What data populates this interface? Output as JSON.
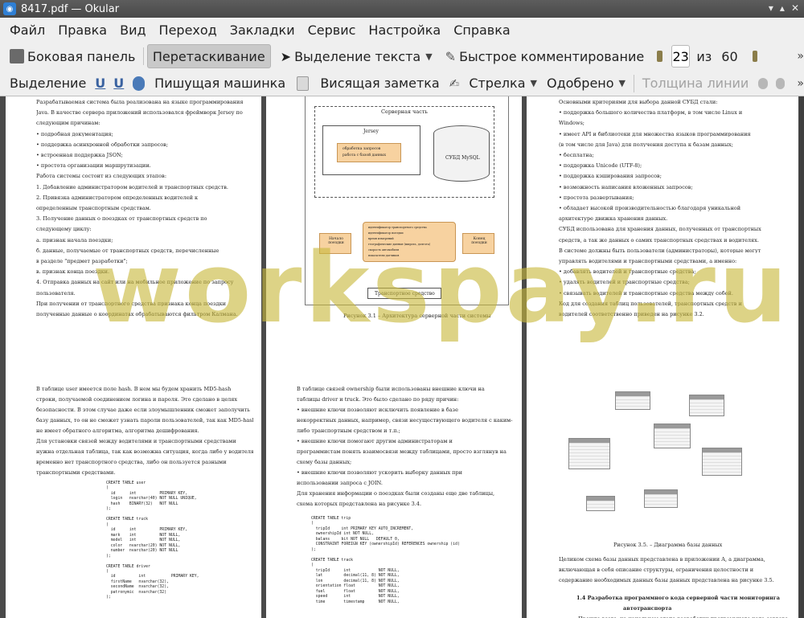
{
  "window": {
    "title": "8417.pdf — Okular"
  },
  "menu": [
    "Файл",
    "Правка",
    "Вид",
    "Переход",
    "Закладки",
    "Сервис",
    "Настройка",
    "Справка"
  ],
  "toolbar1": {
    "sidebar": "Боковая панель",
    "drag": "Перетаскивание",
    "select_text": "Выделение текста",
    "quick_comment": "Быстрое комментирование",
    "current_page": "23",
    "of_label": "из",
    "total_pages": "60"
  },
  "toolbar2": {
    "selection": "Выделение",
    "typewriter": "Пишущая машинка",
    "sticky_note": "Висящая заметка",
    "arrow": "Стрелка",
    "approved": "Одобрено",
    "line_width": "Толщина линии"
  },
  "watermark": "workspay.ru",
  "pages": {
    "p20": {
      "number": "20",
      "lines": [
        "Разрабатываемая система была реализована на языке программирования",
        "Java. В качестве сервера приложений использовался фреймворк Jersey по",
        "следующим причинам:",
        "•       подробная документация;",
        "•       поддержка асинхронной обработки запросов;",
        "•       встроенная поддержка JSON;",
        "•       простота организации маршрутизации.",
        "Работа системы состоит из следующих этапов:",
        "1.      Добавление администратором водителей и транспортных средств.",
        "2.      Привязка администратором определенных водителей к",
        "определенным транспортным средствам.",
        "3.      Получение данных о поездках от транспортных средств по",
        "следующему циклу:",
        "а.      признак начала поездки;",
        "б.      данные, получаемые от транспортных средств, перечисленные",
        "в разделе \"предмет разработки\";",
        "в.      признак конца поездки.",
        "4.      Отправка данных на сайт или на мобильное приложение по запросу",
        "пользователя.",
        "При получении от транспортного средства признака конца поездки",
        "полученные данные о координатах обрабатываются фильтром Калмана."
      ]
    },
    "p21": {
      "number": "21",
      "server_part": "Серверная часть",
      "jersey": "Jersey",
      "jersey_items": [
        "обработка запросов",
        "работа с базой данных"
      ],
      "dbms": "СУБД MySQL",
      "start_trip": "Начало поездки",
      "end_trip": "Конец поездки",
      "middle_items": [
        "идентификатор транспортного средства",
        "идентификатор поездки",
        "время измерений",
        "географические данные (широта, долгота)",
        "скорость автомобиля",
        "показатели датчиков"
      ],
      "vehicle": "Транспортное средство",
      "caption": "Рисунок 3.1 – Архитектура серверной части системы"
    },
    "p22": {
      "number": "22",
      "lines": [
        "Основными критериями для выбора данной СУБД стали:",
        "•       поддержка большого количества платформ, в том числе Linux и",
        "Windows;",
        "•       имеет API и библиотеки для множества языков программирования",
        "(в том числе для Java) для получения доступа к базам данных;",
        "•       бесплатна;",
        "•       поддержка Unicode (UTF-8);",
        "•       поддержка кэширования запросов;",
        "•       возможность написания вложенных запросов;",
        "•       простота развертывания;",
        "•       обладает высокой производительностью благодаря уникальной",
        "архитектуре движка хранения данных.",
        "СУБД использована для хранения данных, полученных от транспортных",
        "средств, а так же данных о самих транспортных средствах и водителях.",
        "В системе должны быть пользователи (администраторы), которые могут",
        "управлять водителями и транспортными средствами, а именно:",
        "•       добавлять водителей и транспортные средства;",
        "•       удалять водителей и транспортные средства;",
        "•       связывать водителей и транспортные средства между собой.",
        "Код для создания таблиц пользователей, транспортных средств и",
        "водителей соответственно приведен на рисунке 3.2."
      ]
    },
    "p23": {
      "lines": [
        "В таблице user имеется поле hash. В нем мы будем хранить MD5-hash",
        "строки, получаемой соединением логина и пароля. Это сделано в целях",
        "безопасности. В этом случае даже если злоумышленник сможет заполучить",
        "базу данных, то он не сможет узнать пароли пользователей, так как MD5-hash",
        "не имеет обратного алгоритма, алгоритма дешифрования.",
        "Для установки связей между водителями и транспортными средствами",
        "нужна отдельная таблица, так как возможна ситуация, когда либо у водителя",
        "временно нет транспортного средства, либо он пользуется разными",
        "транспортными средствами."
      ],
      "code": "CREATE TABLE user\n(\n  id      int          PRIMARY KEY,\n  login   nvarchar(40) NOT NULL UNIQUE,\n  hash    BINARY(32)   NOT NULL\n);\n\nCREATE TABLE truck\n(\n  id      int          PRIMARY KEY,\n  mark    int          NOT NULL,\n  model   int          NOT NULL,\n  color   nvarchar(20) NOT NULL,\n  number  nvarchar(20) NOT NULL\n);\n\nCREATE TABLE driver\n(\n  id          int           PRIMARY KEY,\n  firstName   nvarchar(32),\n  secondName  nvarchar(32),\n  patronymic  nvarchar(32)\n);"
    },
    "p24": {
      "lines": [
        "В таблице связей ownership были использованы внешние ключи на",
        "таблицы driver и truck. Это было сделано по ряду причин:",
        "•       внешние ключи позволяют исключить появление в базе",
        "некорректных данных, например, связи несуществующего водителя с каким-",
        "либо транспортным средством и т.п.;",
        "•       внешние ключи помогают другим администраторам и",
        "программистам понять взаимосвязи между таблицами, просто взглянув на",
        "схему базы данных;",
        "•       внешние ключи позволяют ускорить выборку данных при",
        "использовании запроса с JOIN.",
        "Для хранения информации о поездках были созданы еще две таблицы,",
        "схема которых представлена на рисунке 3.4."
      ],
      "code": "CREATE TABLE trip\n(\n  tripId     int PRIMARY KEY AUTO_INCREMENT,\n  ownershipId int NOT NULL,\n  balans     bit NOT NULL   DEFAULT 0,\n  CONSTRAINT FOREIGN KEY (ownershipId) REFERENCES ownership (id)\n);\n\nCREATE TABLE track\n(\n  tripId      int            NOT NULL,\n  lat         decimal(11, 8) NOT NULL,\n  lon         decimal(11, 8) NOT NULL,\n  orientation float          NOT NULL,\n  fuel        float          NOT NULL,\n  speed       int            NOT NULL,\n  time        timestamp      NOT NULL,"
    },
    "p25": {
      "caption": "Рисунок 3.5. – Диаграмма базы данных",
      "lines": [
        "Целиком схема базы данных представлена в приложении А, а диаграмма,",
        "включающая в себя описание структуры, ограничения целостности и",
        "содержание необходимых данных базы данных представлена на рисунке 3.5."
      ],
      "heading1": "1.4     Разработка программного кода серверной части мониторинга",
      "heading2": "автотранспорта",
      "last_line": "Прежде всего, на начальном этапе разработки программного кода сервера"
    }
  }
}
